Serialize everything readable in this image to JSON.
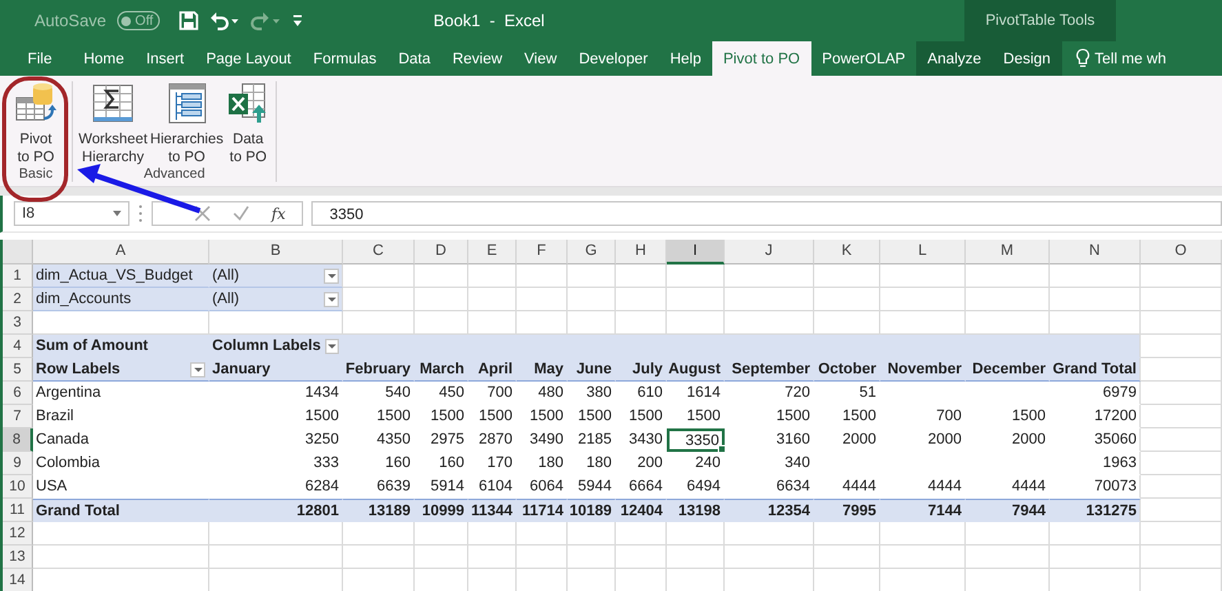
{
  "title_bar": {
    "autosave": {
      "label": "AutoSave",
      "state_text": "Off",
      "on": false
    },
    "title": "Book1  -  Excel",
    "context_header": "PivotTable Tools"
  },
  "tabs": [
    {
      "label": "File",
      "selected": false,
      "contextual": false
    },
    {
      "label": "Home",
      "selected": false,
      "contextual": false
    },
    {
      "label": "Insert",
      "selected": false,
      "contextual": false
    },
    {
      "label": "Page Layout",
      "selected": false,
      "contextual": false
    },
    {
      "label": "Formulas",
      "selected": false,
      "contextual": false
    },
    {
      "label": "Data",
      "selected": false,
      "contextual": false
    },
    {
      "label": "Review",
      "selected": false,
      "contextual": false
    },
    {
      "label": "View",
      "selected": false,
      "contextual": false
    },
    {
      "label": "Developer",
      "selected": false,
      "contextual": false
    },
    {
      "label": "Help",
      "selected": false,
      "contextual": false
    },
    {
      "label": "Pivot to PO",
      "selected": true,
      "contextual": false
    },
    {
      "label": "PowerOLAP",
      "selected": false,
      "contextual": false
    },
    {
      "label": "Analyze",
      "selected": false,
      "contextual": true
    },
    {
      "label": "Design",
      "selected": false,
      "contextual": true
    }
  ],
  "tell_me": "Tell me wh",
  "ribbon": {
    "groups": [
      {
        "label": "Basic",
        "buttons": [
          {
            "kind": "pivot",
            "lines": [
              "Pivot",
              "to PO"
            ]
          }
        ]
      },
      {
        "label": "Advanced",
        "buttons": [
          {
            "kind": "sum",
            "lines": [
              "Worksheet",
              "Hierarchy"
            ]
          },
          {
            "kind": "hierarchy",
            "lines": [
              "Hierarchies",
              "to PO"
            ]
          },
          {
            "kind": "data",
            "lines": [
              "Data",
              "to PO"
            ]
          }
        ]
      }
    ]
  },
  "formula_bar": {
    "name_box": "I8",
    "function_label": "fx",
    "value": "3350"
  },
  "sheet": {
    "columns": [
      {
        "label": "A",
        "selected": false
      },
      {
        "label": "B",
        "selected": false
      },
      {
        "label": "C",
        "selected": false
      },
      {
        "label": "D",
        "selected": false
      },
      {
        "label": "E",
        "selected": false
      },
      {
        "label": "F",
        "selected": false
      },
      {
        "label": "G",
        "selected": false
      },
      {
        "label": "H",
        "selected": false
      },
      {
        "label": "I",
        "selected": true
      },
      {
        "label": "J",
        "selected": false
      },
      {
        "label": "K",
        "selected": false
      },
      {
        "label": "L",
        "selected": false
      },
      {
        "label": "M",
        "selected": false
      },
      {
        "label": "N",
        "selected": false
      },
      {
        "label": "O",
        "selected": false
      }
    ],
    "rows": [
      {
        "number": "1",
        "selected": false,
        "kind": "filter",
        "cells": [
          "dim_Actua_VS_Budget",
          {
            "text": "(All)",
            "dropdown": true
          }
        ]
      },
      {
        "number": "2",
        "selected": false,
        "kind": "filter",
        "cells": [
          "dim_Accounts",
          {
            "text": "(All)",
            "dropdown": true
          }
        ]
      },
      {
        "number": "3",
        "selected": false,
        "kind": "empty",
        "cells": []
      },
      {
        "number": "4",
        "selected": false,
        "kind": "caption",
        "cells": [
          "Sum of Amount",
          {
            "text": "Column Labels",
            "dropdown": true
          }
        ]
      },
      {
        "number": "5",
        "selected": false,
        "kind": "header",
        "cells": [
          {
            "text": "Row Labels",
            "dropdown": true
          },
          "January",
          "February",
          "March",
          "April",
          "May",
          "June",
          "July",
          "August",
          "September",
          "October",
          "November",
          "December",
          "Grand Total"
        ]
      },
      {
        "number": "6",
        "selected": false,
        "kind": "data",
        "cells": [
          "Argentina",
          "1434",
          "540",
          "450",
          "700",
          "480",
          "380",
          "610",
          "1614",
          "720",
          "51",
          "",
          "",
          "6979"
        ]
      },
      {
        "number": "7",
        "selected": false,
        "kind": "data",
        "cells": [
          "Brazil",
          "1500",
          "1500",
          "1500",
          "1500",
          "1500",
          "1500",
          "1500",
          "1500",
          "1500",
          "1500",
          "700",
          "1500",
          "17200"
        ]
      },
      {
        "number": "8",
        "selected": true,
        "kind": "data",
        "cells": [
          "Canada",
          "3250",
          "4350",
          "2975",
          "2870",
          "3490",
          "2185",
          "3430",
          {
            "text": "3350",
            "active": true
          },
          "3160",
          "2000",
          "2000",
          "2000",
          "35060"
        ]
      },
      {
        "number": "9",
        "selected": false,
        "kind": "data",
        "cells": [
          "Colombia",
          "333",
          "160",
          "160",
          "170",
          "180",
          "180",
          "200",
          "240",
          "340",
          "",
          "",
          "",
          "1963"
        ]
      },
      {
        "number": "10",
        "selected": false,
        "kind": "data",
        "cells": [
          "USA",
          "6284",
          "6639",
          "5914",
          "6104",
          "6064",
          "5944",
          "6664",
          "6494",
          "6634",
          "4444",
          "4444",
          "4444",
          "70073"
        ]
      },
      {
        "number": "11",
        "selected": false,
        "kind": "total",
        "cells": [
          "Grand Total",
          "12801",
          "13189",
          "10999",
          "11344",
          "11714",
          "10189",
          "12404",
          "13198",
          "12354",
          "7995",
          "7144",
          "7944",
          "131275"
        ]
      },
      {
        "number": "12",
        "selected": false,
        "kind": "empty",
        "cells": []
      },
      {
        "number": "13",
        "selected": false,
        "kind": "empty",
        "cells": []
      },
      {
        "number": "14",
        "selected": false,
        "kind": "empty",
        "cells": []
      }
    ]
  }
}
